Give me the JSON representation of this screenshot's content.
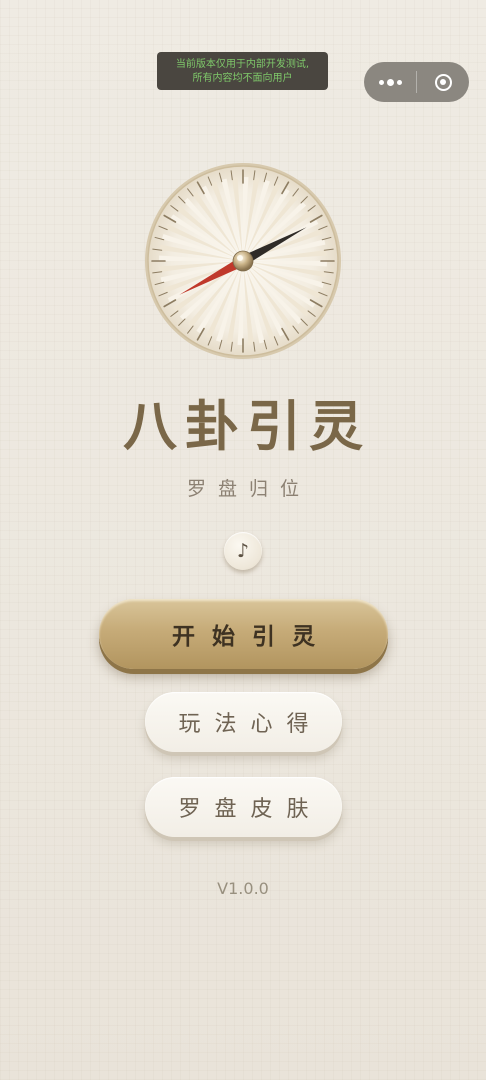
{
  "dev_notice": {
    "line1": "当前版本仅用于内部开发测试,",
    "line2": "所有内容均不面向用户"
  },
  "capsule": {
    "more_icon": "more-dots-icon",
    "close_icon": "target-close-icon"
  },
  "compass": {
    "needle_north_color": "#2f2b27",
    "needle_south_color": "#c0392b",
    "needle_heading_degrees": 62
  },
  "title": "八卦引灵",
  "subtitle": "罗盘归位",
  "music_button": {
    "icon": "♪",
    "icon_name": "music-note-icon"
  },
  "buttons": {
    "start": "开始引灵",
    "rules": "玩法心得",
    "skin": "罗盘皮肤"
  },
  "version": "V1.0.0",
  "colors": {
    "gold": "#c6ab78",
    "title_brown": "#7a6748",
    "background": "#efebe3"
  }
}
